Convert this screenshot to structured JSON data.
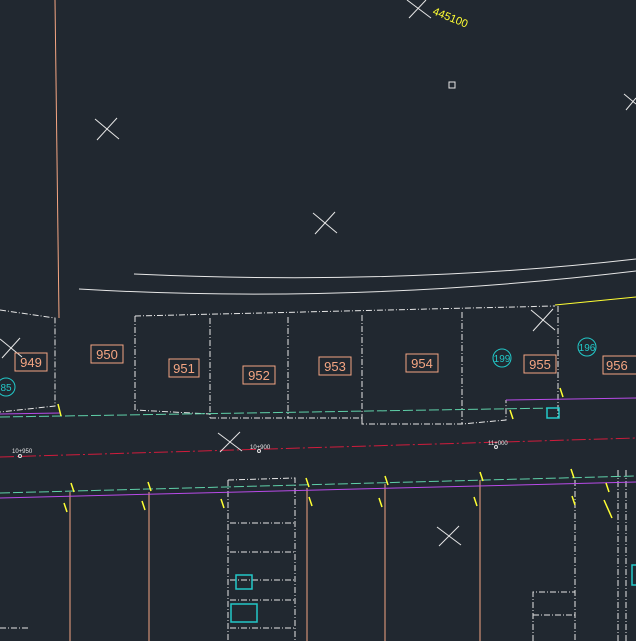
{
  "drawing": {
    "background": "#212830",
    "colors": {
      "lot": "#f4a582",
      "fence": "#e6e6e6",
      "chainage": "#ffff33",
      "cyan": "#22c8c8",
      "red_line": "#d01c3c",
      "purple_line": "#b84be8",
      "green_line": "#5fd0a8"
    },
    "lot_numbers": [
      "949",
      "950",
      "951",
      "952",
      "953",
      "954",
      "955",
      "956"
    ],
    "circle_labels": [
      "199",
      "196"
    ],
    "circle_label_partial": "85",
    "top_label": "445100",
    "chainages": {
      "ch_10_950": "10+950",
      "ch_10_900": "10+900",
      "ch_11_000": "11+000"
    }
  }
}
